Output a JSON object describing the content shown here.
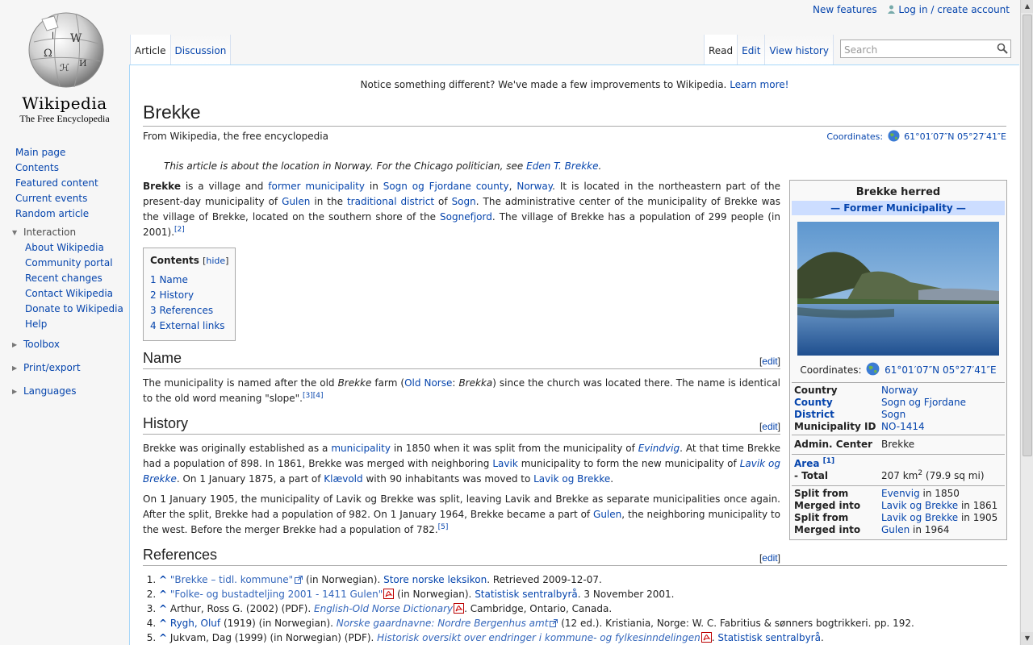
{
  "personal": {
    "new_features": "New features",
    "login": "Log in / create account"
  },
  "logo": {
    "wordmark": "Wikipedia",
    "tagline": "The Free Encyclopedia"
  },
  "sidebar": {
    "main": [
      "Main page",
      "Contents",
      "Featured content",
      "Current events",
      "Random article"
    ],
    "interaction_title": "Interaction",
    "interaction": [
      "About Wikipedia",
      "Community portal",
      "Recent changes",
      "Contact Wikipedia",
      "Donate to Wikipedia",
      "Help"
    ],
    "toolbox": "Toolbox",
    "printexport": "Print/export",
    "languages": "Languages"
  },
  "tabs": {
    "article": "Article",
    "discussion": "Discussion",
    "read": "Read",
    "edit": "Edit",
    "history": "View history"
  },
  "search": {
    "placeholder": "Search"
  },
  "notice": {
    "text": "Notice something different? We've made a few improvements to Wikipedia.",
    "link": "Learn more!"
  },
  "article": {
    "title": "Brekke",
    "sitesub": "From Wikipedia, the free encyclopedia",
    "coords_label": "Coordinates:",
    "coords": "61°01′07″N 05°27′41″E",
    "hatnote_pre": "This article is about the location in Norway. For the Chicago politician, see",
    "hatnote_link": "Eden T. Brekke",
    "lead": {
      "b": "Brekke",
      "t1": " is a village and ",
      "l1": "former municipality",
      "t2": " in ",
      "l2": "Sogn og Fjordane county",
      "t3": ", ",
      "l3": "Norway",
      "t4": ". It is located in the northeastern part of the present-day municipality of ",
      "l4": "Gulen",
      "t5": " in the ",
      "l5": "traditional district",
      "t6": " of ",
      "l6": "Sogn",
      "t7": ". The administrative center of the municipality of Brekke was the village of Brekke, located on the southern shore of the ",
      "l7": "Sognefjord",
      "t8": ". The village of Brekke has a population of 299 people (in 2001).",
      "ref": "[2]"
    },
    "toc": {
      "title": "Contents",
      "hide": "hide",
      "items": [
        "1 Name",
        "2 History",
        "3 References",
        "4 External links"
      ]
    },
    "edit_label": "edit",
    "name_section": {
      "heading": "Name",
      "t1": "The municipality is named after the old ",
      "i1": "Brekke",
      "t2": " farm (",
      "l1": "Old Norse",
      "t3": ": ",
      "i2": "Brekka",
      "t4": ") since the church was located there. The name is identical to the old word meaning \"slope\".",
      "ref": "[3][4]"
    },
    "history_section": {
      "heading": "History",
      "p1": {
        "t1": "Brekke was originally established as a ",
        "l1": "municipality",
        "t2": " in 1850 when it was split from the municipality of ",
        "l2": "Evindvig",
        "t3": ". At that time Brekke had a population of 898. In 1861, Brekke was merged with neighboring ",
        "l3": "Lavik",
        "t4": " municipality to form the new municipality of ",
        "l4": "Lavik og Brekke",
        "t5": ". On 1 January 1875, a part of ",
        "l5": "Klævold",
        "t6": " with 90 inhabitants was moved to ",
        "l6": "Lavik og Brekke",
        "t7": "."
      },
      "p2": {
        "t1": "On 1 January 1905, the municipality of Lavik og Brekke was split, leaving Lavik and Brekke as separate municipalities once again. After the split, Brekke had a population of 982. On 1 January 1964, Brekke became a part of ",
        "l1": "Gulen",
        "t2": ", the neighboring municipality to the west. Before the merger Brekke had a population of 782.",
        "ref": "[5]"
      }
    },
    "references_section": {
      "heading": "References",
      "items": [
        {
          "caret": "^",
          "link": "\"Brekke – tidl. kommune\"",
          "t1": " (in Norwegian). ",
          "l2": "Store norske leksikon",
          "t2": ". Retrieved 2009-12-07."
        },
        {
          "caret": "^",
          "link": "\"Folke- og bustadteljing 2001 - 1411 Gulen\"",
          "t1": " (in Norwegian). ",
          "l2": "Statistisk sentralbyrå",
          "t2": ". 3 November 2001."
        },
        {
          "caret": "^",
          "t0": "Arthur, Ross G. (2002) (PDF). ",
          "link": "English-Old Norse Dictionary",
          "t2": ". Cambridge, Ontario, Canada."
        },
        {
          "caret": "^",
          "a0": "Rygh, Oluf",
          "t0": " (1919) (in Norwegian). ",
          "link": "Norske gaardnavne: Nordre Bergenhus amt",
          "t2": " (12 ed.). Kristiania, Norge: W. C. Fabritius & sønners bogtrikkeri. pp. 192."
        },
        {
          "caret": "^",
          "t0": "Jukvam, Dag (1999) (in Norwegian) (PDF). ",
          "link": "Historisk oversikt over endringer i kommune- og fylkesinndelingen",
          "t1": ". ",
          "l2": "Statistisk sentralbyrå",
          "t2": "."
        }
      ]
    }
  },
  "infobox": {
    "title": "Brekke herred",
    "subtitle": "— Former Municipality —",
    "coords_label": "Coordinates:",
    "coords": "61°01′07″N 05°27′41″E",
    "rows1": [
      {
        "k": "Country",
        "v": "Norway",
        "klink": false
      },
      {
        "k": "County",
        "v": "Sogn og Fjordane",
        "klink": true
      },
      {
        "k": "District",
        "v": "Sogn",
        "klink": true
      },
      {
        "k": "Municipality ID",
        "v": "NO-1414",
        "klink": false
      }
    ],
    "admin_k": "Admin. Center",
    "admin_v": "Brekke",
    "area_k": "Area",
    "area_ref": "[1]",
    "total_k": " - Total",
    "total_v": "207 km",
    "total_sup": "2",
    "total_v2": " (79.9 sq mi)",
    "rows3": [
      {
        "k": "Split from",
        "l": "Evenvig",
        "t": " in 1850"
      },
      {
        "k": "Merged into",
        "l": "Lavik og Brekke",
        "t": " in 1861"
      },
      {
        "k": "Split from",
        "l": "Lavik og Brekke",
        "t": " in 1905"
      },
      {
        "k": "Merged into",
        "l": "Gulen",
        "t": " in 1964"
      }
    ]
  }
}
